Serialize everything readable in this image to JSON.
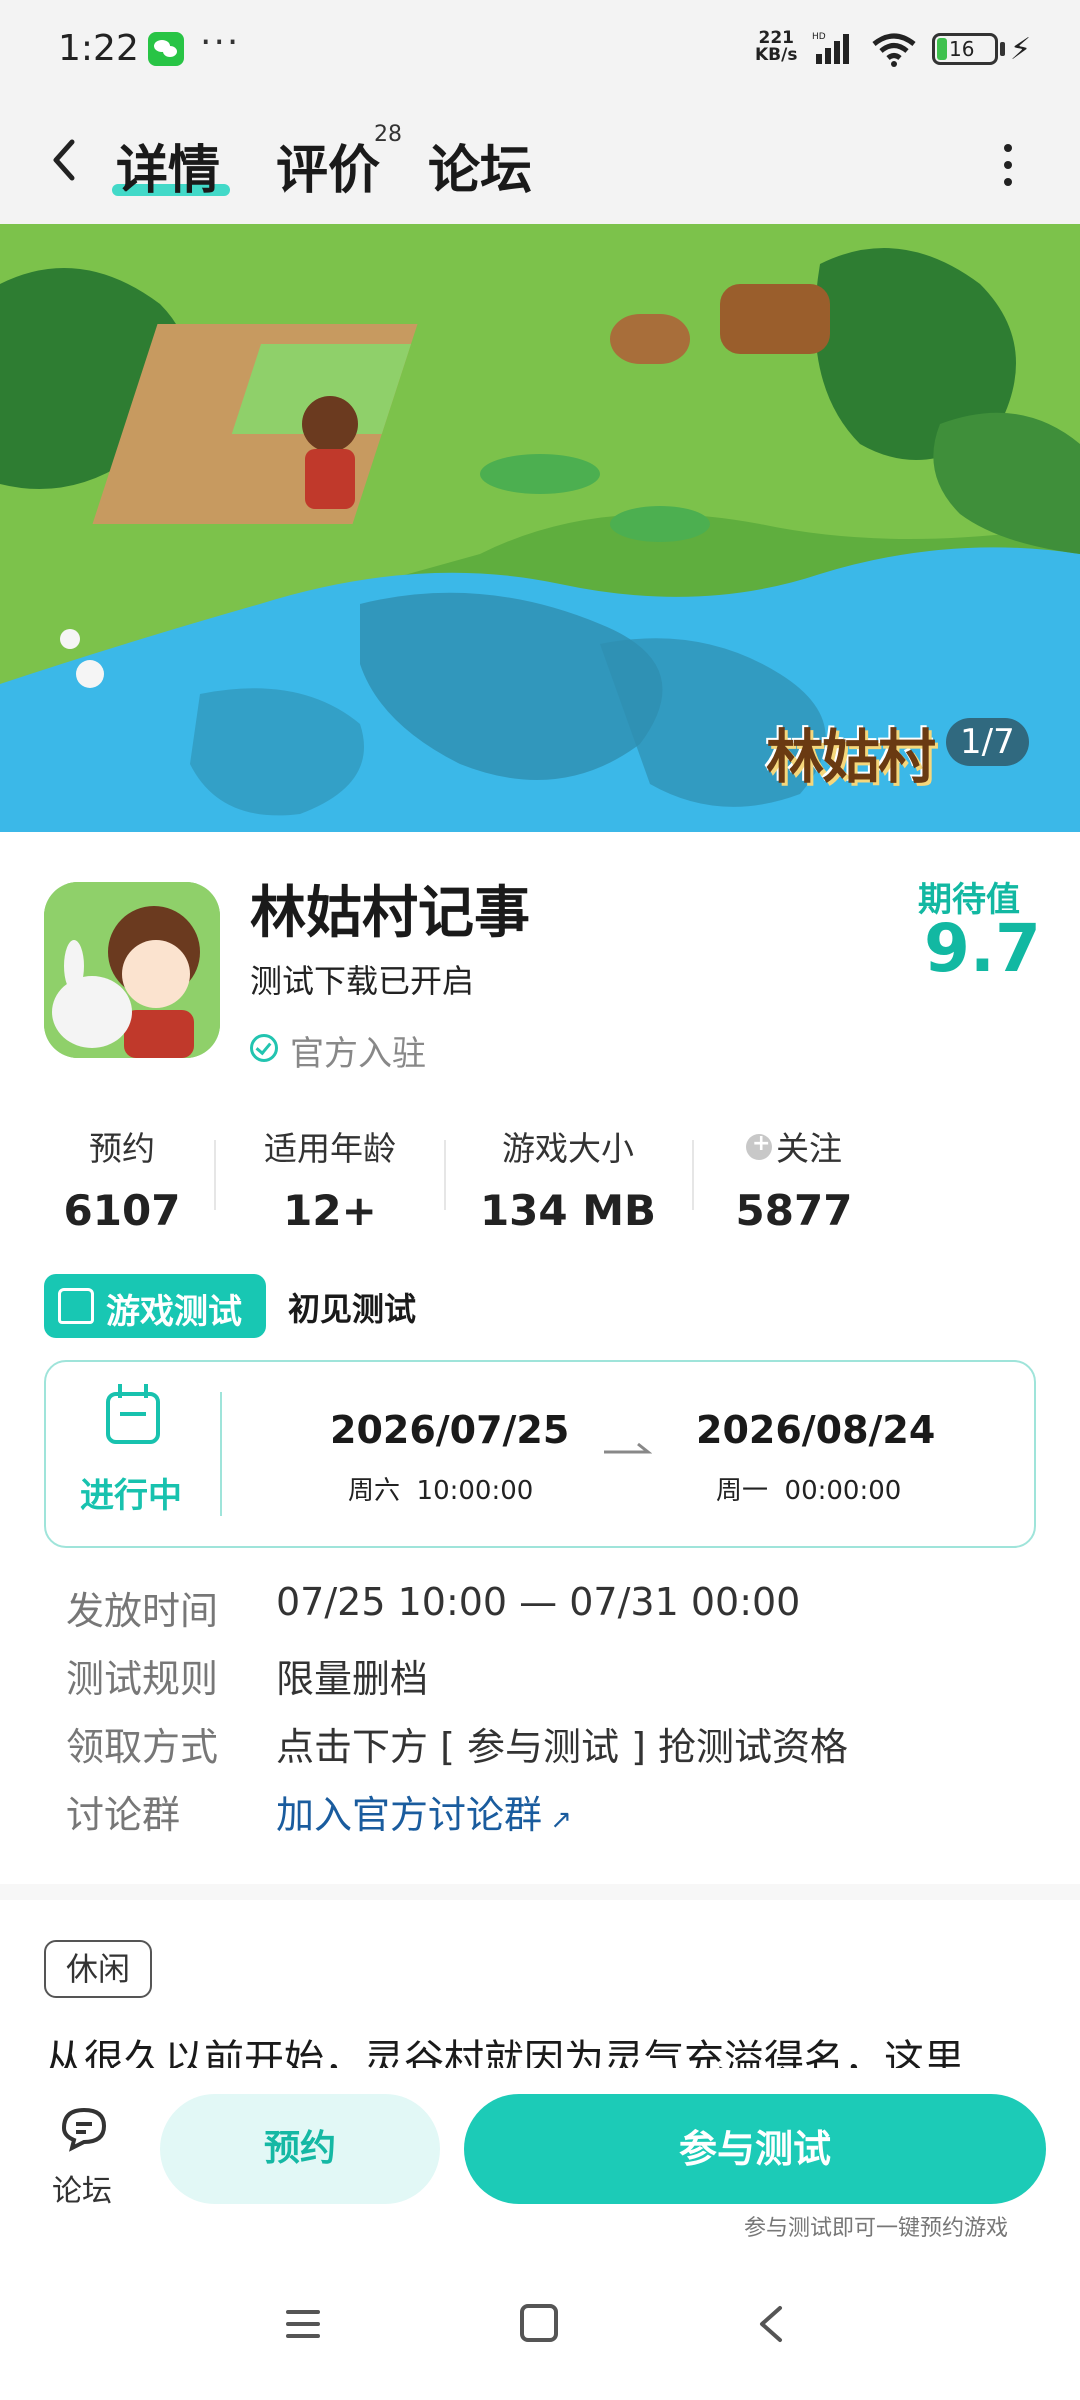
{
  "status_bar": {
    "time": "1:22",
    "more": "···",
    "net_speed_value": "221",
    "net_speed_unit": "KB/s",
    "battery": "16"
  },
  "nav": {
    "tabs": [
      {
        "label": "详情"
      },
      {
        "label": "评价"
      },
      {
        "label": "论坛"
      }
    ],
    "review_count": "28"
  },
  "banner": {
    "logo_text": "林姑村",
    "counter": "1/7"
  },
  "game": {
    "name": "林姑村记事",
    "subtitle": "测试下载已开启",
    "official_label": "官方入驻",
    "rating_label": "期待值",
    "rating_value": "9.7"
  },
  "stats": [
    {
      "label": "预约",
      "value": "6107"
    },
    {
      "label": "适用年龄",
      "value": "12+"
    },
    {
      "label": "游戏大小",
      "value": "134 MB"
    },
    {
      "label": "关注",
      "value": "5877"
    }
  ],
  "test": {
    "badge_label": "游戏测试",
    "phase": "初见测试",
    "status": "进行中",
    "start_date": "2026/07/25",
    "start_time": "周六  10:00:00",
    "end_date": "2026/08/24",
    "end_time": "周一  00:00:00"
  },
  "info_rows": [
    {
      "label": "发放时间",
      "value": "07/25 10:00 — 07/31 00:00"
    },
    {
      "label": "测试规则",
      "value": "限量删档"
    },
    {
      "label": "领取方式",
      "value": "点击下方 [ 参与测试 ] 抢测试资格"
    },
    {
      "label": "讨论群",
      "value": "加入官方讨论群"
    }
  ],
  "genre_tag": "休闲",
  "description": "从很久以前开始，灵谷村就因为灵气充溢得名，这里",
  "actions": {
    "forum_label": "论坛",
    "reserve_label": "预约",
    "join_label": "参与测试",
    "join_hint": "参与测试即可一键预约游戏"
  },
  "colors": {
    "accent": "#1ccbb7",
    "link": "#1a5c9e",
    "rating": "#12b8a2"
  }
}
